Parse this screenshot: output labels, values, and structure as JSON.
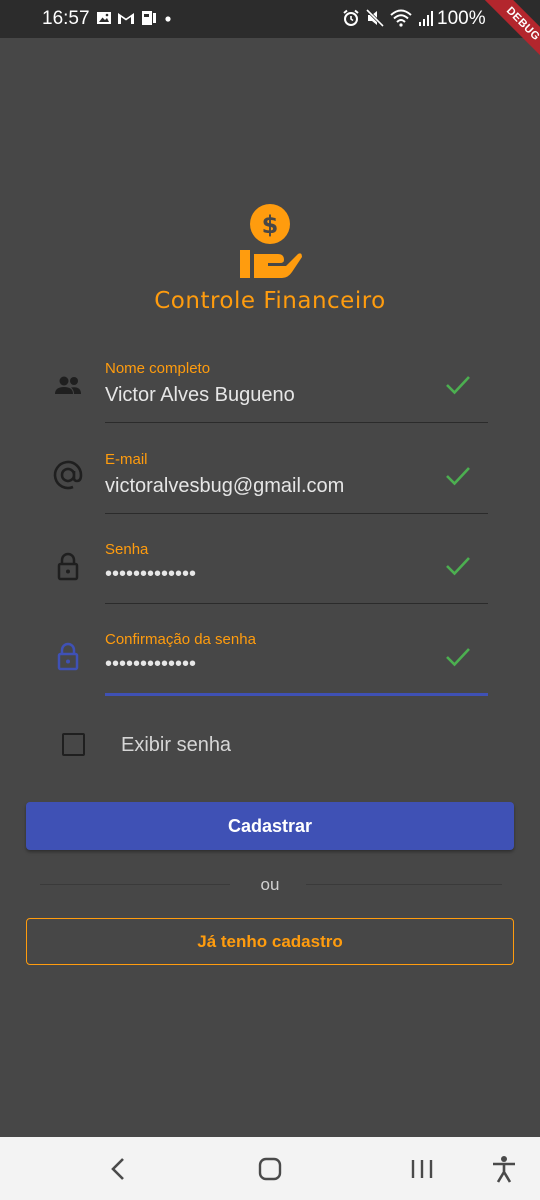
{
  "status_bar": {
    "time": "16:57",
    "battery": "100%",
    "left_icons": [
      "image-icon",
      "gmail-icon",
      "cast-icon",
      "dot-icon"
    ],
    "right_icons": [
      "alarm-icon",
      "mute-icon",
      "wifi-icon",
      "signal-icon"
    ],
    "debug_ribbon": "DEBUG"
  },
  "app": {
    "title": "Controle Financeiro",
    "logo_icon": "money-hand-icon",
    "accent_color": "#ff9c0e",
    "primary_color": "#3f51b5",
    "success_color": "#4caf50"
  },
  "form": {
    "fields": [
      {
        "label": "Nome completo",
        "value": "Victor Alves Bugueno",
        "icon": "people-icon",
        "valid": true
      },
      {
        "label": "E-mail",
        "value": "victoralvesbug@gmail.com",
        "icon": "at-icon",
        "valid": true
      },
      {
        "label": "Senha",
        "value": "•••••••••••••",
        "icon": "lock-icon",
        "valid": true
      },
      {
        "label": "Confirmação da senha",
        "value": "•••••••••••••",
        "icon": "lock-icon",
        "valid": true,
        "focused": true
      }
    ],
    "show_password_label": "Exibir senha",
    "show_password_checked": false,
    "submit_label": "Cadastrar",
    "divider_text": "ou",
    "login_label": "Já tenho cadastro"
  },
  "nav_bar": {
    "buttons": [
      "back-icon",
      "home-icon",
      "recents-icon",
      "accessibility-icon"
    ]
  }
}
